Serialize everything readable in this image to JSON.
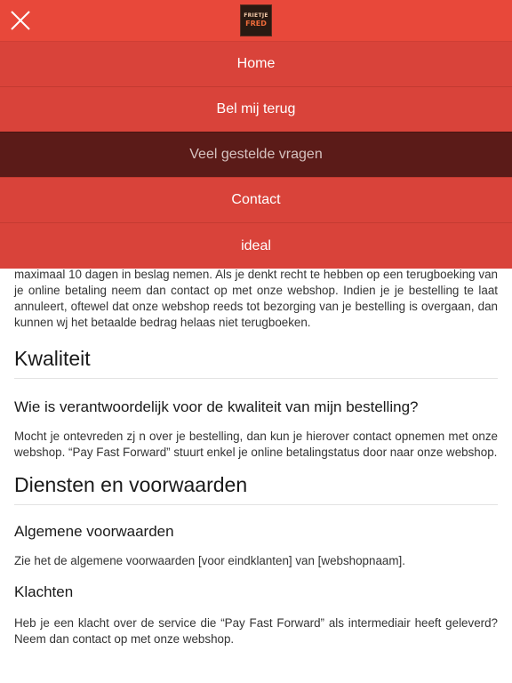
{
  "header": {
    "logo_line1": "FRIETJE",
    "logo_line2": "FRED"
  },
  "menu": {
    "items": [
      {
        "label": "Home"
      },
      {
        "label": "Bel mij terug"
      },
      {
        "label": "Veel gestelde vragen"
      },
      {
        "label": "Contact"
      },
      {
        "label": "ideal"
      }
    ],
    "active_index": 2
  },
  "content": {
    "intro_text": "maximaal 10 dagen in beslag nemen. Als je denkt recht te hebben op een terugboeking van je online betaling neem dan contact op met onze webshop. Indien je je bestelling te laat annuleert, oftewel dat onze webshop reeds tot bezorging van je bestelling is overgaan, dan kunnen wj  het betaalde bedrag helaas niet terugboeken.",
    "section1": {
      "title": "Kwaliteit",
      "question": "Wie is verantwoordelijk voor de kwaliteit van mijn bestelling?",
      "answer": "Mocht je ontevreden zj n over je bestelling, dan kun je hierover contact opnemen met onze webshop. “Pay Fast Forward” stuurt enkel je online betalingstatus door naar onze webshop."
    },
    "section2": {
      "title": "Diensten en voorwaarden",
      "sub1_title": "Algemene voorwaarden",
      "sub1_text": "Zie het de algemene voorwaarden [voor eindklanten] van [webshopnaam].",
      "sub2_title": "Klachten",
      "sub2_text": "Heb je een klacht over de service die “Pay Fast Forward” als intermediair heeft geleverd? Neem dan contact op met onze webshop."
    }
  },
  "colors": {
    "topbar": "#e8483a",
    "menu_item": "#d9433a",
    "menu_active": "#5b1b18"
  }
}
